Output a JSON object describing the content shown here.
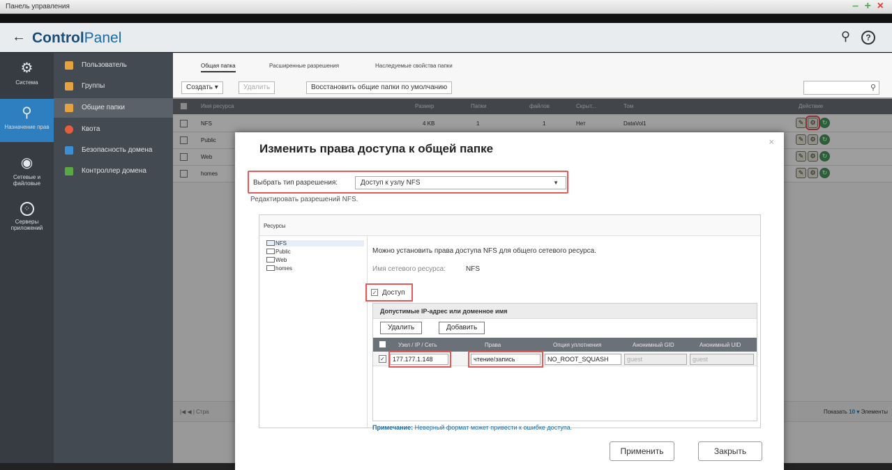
{
  "window": {
    "title": "Панель управления"
  },
  "header": {
    "brand_bold": "Control",
    "brand_light": "Panel"
  },
  "leftnav": [
    {
      "label": "Система",
      "icon": "gear-icon"
    },
    {
      "label": "Назначение прав",
      "icon": "user-icon"
    },
    {
      "label": "Сетевые и файловые",
      "icon": "globe-icon"
    },
    {
      "label": "Серверы приложений",
      "icon": "apps-icon"
    }
  ],
  "subnav": [
    {
      "label": "Пользователь",
      "color": "#e6a23c"
    },
    {
      "label": "Группы",
      "color": "#e6a23c"
    },
    {
      "label": "Общие папки",
      "color": "#e6a23c"
    },
    {
      "label": "Квота",
      "color": "#e65c3c"
    },
    {
      "label": "Безопасность домена",
      "color": "#3a8fd6"
    },
    {
      "label": "Контроллер домена",
      "color": "#58a844"
    }
  ],
  "tabs": [
    "Общая папка",
    "Расширенные разрешения",
    "Наследуемые свойства папки"
  ],
  "toolbar": {
    "create": "Создать ▾",
    "delete": "Удалить",
    "restore": "Восстановить общие папки по умолчанию"
  },
  "grid": {
    "headers": [
      "Имя ресурса",
      "Размер",
      "Папки",
      "файлов",
      "Скрыт...",
      "Том",
      "Действие"
    ],
    "rows": [
      {
        "name": "NFS",
        "size": "4 KB",
        "folders": "1",
        "files": "1",
        "hidden": "Нет",
        "volume": "DataVol1"
      },
      {
        "name": "Public"
      },
      {
        "name": "Web"
      },
      {
        "name": "homes"
      }
    ]
  },
  "pager": {
    "left": "|◀  ◀  |  Стра",
    "show": "Показать",
    "count": "10",
    "items": "Элементы"
  },
  "dialog": {
    "title": "Изменить права доступа к общей папке",
    "perm_label": "Выбрать тип разрешения:",
    "perm_value": "Доступ к узлу NFS",
    "edit_note": "Редактировать разрешений NFS.",
    "resources_label": "Ресурсы",
    "tree": [
      "NFS",
      "Public",
      "Web",
      "homes"
    ],
    "desc": "Можно установить права доступа NFS для общего сетевого ресурса.",
    "share_label": "Имя сетевого ресурса:",
    "share_value": "NFS",
    "access_label": "Доступ",
    "ip_title": "Допустимые IP-адрес или доменное имя",
    "btn_delete": "Удалить",
    "btn_add": "Добавить",
    "ip_headers": [
      "Узел / IP / Сеть",
      "Права",
      "Опция уплотнения",
      "Анонимный GID",
      "Анонимный UID"
    ],
    "ip_row": {
      "host": "177.177.1.148",
      "rights": "чтение/запись",
      "squash": "NO_ROOT_SQUASH",
      "gid": "guest",
      "uid": "guest"
    },
    "note_label": "Примечание:",
    "note_text": "Неверный формат может привести к ошибке доступа.",
    "apply": "Применить",
    "close": "Закрыть"
  },
  "colors": {
    "accent": "#2e7fc0",
    "highlight": "#e05a5a"
  }
}
